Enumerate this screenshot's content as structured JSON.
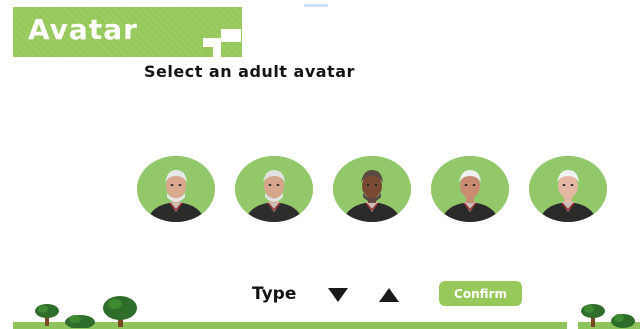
{
  "header": {
    "title": "Avatar"
  },
  "prompt": {
    "text": "Select an adult avatar"
  },
  "avatars": [
    {
      "name": "avatar-option-1",
      "skin": "#d9a98f",
      "hair": "#e8e8e8",
      "beard": true,
      "shirt": "#2b2b2b"
    },
    {
      "name": "avatar-option-2",
      "skin": "#d6a68c",
      "hair": "#e2e2e2",
      "beard": true,
      "shirt": "#2d2d2d"
    },
    {
      "name": "avatar-option-3",
      "skin": "#7a4a34",
      "hair": "#5a4a40",
      "beard": true,
      "shirt": "#2a2a2a"
    },
    {
      "name": "avatar-option-4",
      "skin": "#c98c72",
      "hair": "#f0f0f0",
      "beard": false,
      "shirt": "#2a2a2a"
    },
    {
      "name": "avatar-option-5",
      "skin": "#e4b8a4",
      "hair": "#f2f2f2",
      "beard": false,
      "shirt": "#2a2a2a"
    }
  ],
  "controls": {
    "type_label": "Type",
    "confirm_label": "Confirm"
  },
  "colors": {
    "accent": "#96c85a",
    "avatar_bg": "#92c86a",
    "text": "#141414"
  },
  "icons": {
    "down": "triangle-down-icon",
    "up": "triangle-up-icon"
  }
}
